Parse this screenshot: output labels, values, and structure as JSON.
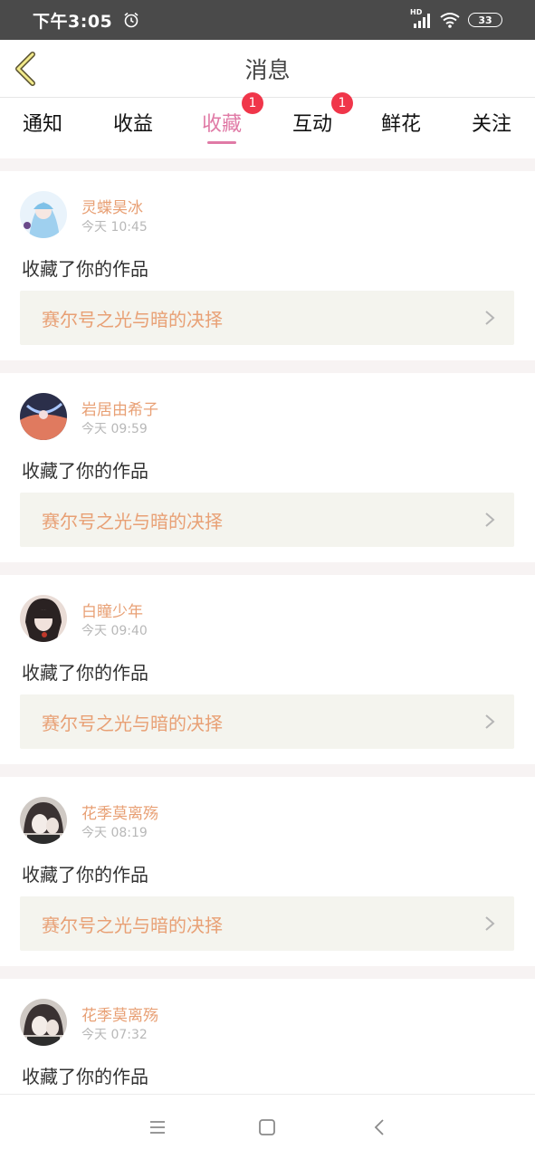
{
  "status_bar": {
    "time": "下午3:05",
    "battery": "33",
    "network_label": "HD"
  },
  "header": {
    "title": "消息"
  },
  "tabs": [
    {
      "label": "通知",
      "badge": ""
    },
    {
      "label": "收益",
      "badge": ""
    },
    {
      "label": "收藏",
      "badge": "1",
      "active": true
    },
    {
      "label": "互动",
      "badge": "1"
    },
    {
      "label": "鲜花",
      "badge": ""
    },
    {
      "label": "关注",
      "badge": ""
    }
  ],
  "items": [
    {
      "user": "灵蝶昊冰",
      "time": "今天 10:45",
      "action": "收藏了你的作品",
      "work": "赛尔号之光与暗的决择"
    },
    {
      "user": "岩居由希子",
      "time": "今天 09:59",
      "action": "收藏了你的作品",
      "work": "赛尔号之光与暗的决择"
    },
    {
      "user": "白瞳少年",
      "time": "今天 09:40",
      "action": "收藏了你的作品",
      "work": "赛尔号之光与暗的决择"
    },
    {
      "user": "花季莫离殇",
      "time": "今天 08:19",
      "action": "收藏了你的作品",
      "work": "赛尔号之光与暗的决择"
    },
    {
      "user": "花季莫离殇",
      "time": "今天 07:32",
      "action": "收藏了你的作品",
      "work": ""
    }
  ],
  "colors": {
    "accent": "#e07aa6",
    "name": "#e8a075",
    "badge": "#f0364a",
    "link_bg": "#f4f4ee"
  }
}
